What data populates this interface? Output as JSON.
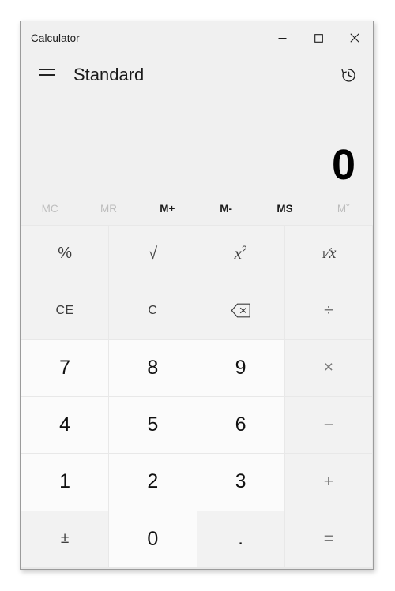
{
  "window": {
    "title": "Calculator",
    "caption_buttons": [
      {
        "name": "minimize",
        "label": "—"
      },
      {
        "name": "maximize",
        "label": "□"
      },
      {
        "name": "close",
        "label": "✕"
      }
    ]
  },
  "header": {
    "menu_icon": "hamburger-menu-icon",
    "mode_title": "Standard",
    "history_icon": "history-clock-icon"
  },
  "display": {
    "expression": "",
    "result": "0"
  },
  "memory": {
    "buttons": [
      {
        "label": "MC",
        "name": "memory-clear",
        "enabled": false
      },
      {
        "label": "MR",
        "name": "memory-recall",
        "enabled": false
      },
      {
        "label": "M+",
        "name": "memory-add",
        "enabled": true
      },
      {
        "label": "M-",
        "name": "memory-subtract",
        "enabled": true
      },
      {
        "label": "MS",
        "name": "memory-store",
        "enabled": true
      },
      {
        "label": "Mˇ",
        "name": "memory-dropdown",
        "enabled": false
      }
    ]
  },
  "keypad": {
    "rows": [
      [
        "%",
        "√",
        "x²",
        "¹⁄ₓ"
      ],
      [
        "CE",
        "C",
        "⌫",
        "÷"
      ],
      [
        "7",
        "8",
        "9",
        "×"
      ],
      [
        "4",
        "5",
        "6",
        "−"
      ],
      [
        "1",
        "2",
        "3",
        "+"
      ],
      [
        "±",
        "0",
        ".",
        "="
      ]
    ],
    "labels": {
      "percent": "%",
      "sqrt": "√",
      "square": "x",
      "square_exp": "2",
      "reciprocal_num": "1",
      "reciprocal_den": "x",
      "clear_entry": "CE",
      "clear": "C",
      "backspace": "⌫",
      "divide": "÷",
      "seven": "7",
      "eight": "8",
      "nine": "9",
      "multiply": "×",
      "four": "4",
      "five": "5",
      "six": "6",
      "subtract": "−",
      "one": "1",
      "two": "2",
      "three": "3",
      "add": "+",
      "negate": "±",
      "zero": "0",
      "decimal": ".",
      "equals": "="
    }
  },
  "colors": {
    "window_bg": "#f0f0f0",
    "digit_key": "#fbfbfb",
    "function_key": "#f2f2f2",
    "separator": "#e8e8e8",
    "text_primary": "#111111",
    "text_disabled": "#bdbdbd",
    "border": "#9b9b9b"
  }
}
